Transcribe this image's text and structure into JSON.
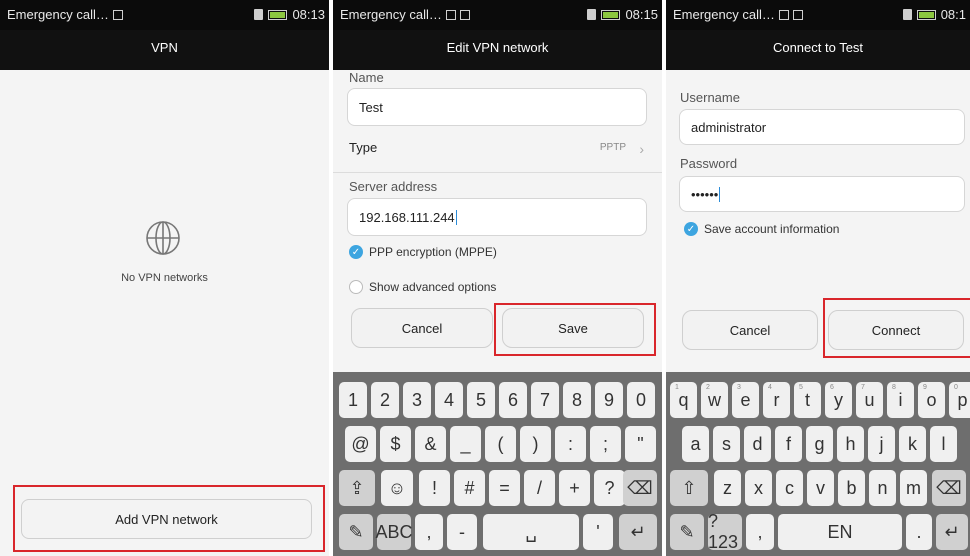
{
  "status": {
    "carrier": "Emergency call…",
    "time1": "08:13",
    "time2": "08:15",
    "time3": "08:1"
  },
  "screen1": {
    "title": "VPN",
    "empty_text": "No VPN networks",
    "add_button": "Add VPN network"
  },
  "screen2": {
    "title": "Edit VPN network",
    "name_label": "Name",
    "name_value": "Test",
    "type_label": "Type",
    "type_value": "PPTP",
    "server_label": "Server address",
    "server_value": "192.168.111.244",
    "encryption_label": "PPP encryption (MPPE)",
    "advanced_label": "Show advanced options",
    "cancel": "Cancel",
    "save": "Save"
  },
  "screen3": {
    "title": "Connect to Test",
    "username_label": "Username",
    "username_value": "administrator",
    "password_label": "Password",
    "password_value": "••••••",
    "save_account": "Save account information",
    "cancel": "Cancel",
    "connect": "Connect"
  },
  "keyboard_num": {
    "row1": [
      "1",
      "2",
      "3",
      "4",
      "5",
      "6",
      "7",
      "8",
      "9",
      "0"
    ],
    "row2": [
      "@",
      "$",
      "&",
      "_",
      "(",
      ")",
      ":",
      ";",
      "\""
    ],
    "row3": [
      "!",
      "#",
      "=",
      "/",
      "+",
      "?"
    ],
    "abc": "ABC"
  },
  "keyboard_alpha": {
    "row1": [
      "q",
      "w",
      "e",
      "r",
      "t",
      "y",
      "u",
      "i",
      "o",
      "p"
    ],
    "row1_hint": [
      "1",
      "2",
      "3",
      "4",
      "5",
      "6",
      "7",
      "8",
      "9",
      "0"
    ],
    "row2": [
      "a",
      "s",
      "d",
      "f",
      "g",
      "h",
      "j",
      "k",
      "l"
    ],
    "row3": [
      "z",
      "x",
      "c",
      "v",
      "b",
      "n",
      "m"
    ],
    "sym": "?123",
    "space_hint": "EN"
  },
  "colors": {
    "highlight": "#d9262b",
    "accent": "#3da5e0",
    "keyboard_bg": "#6e6e6e"
  }
}
